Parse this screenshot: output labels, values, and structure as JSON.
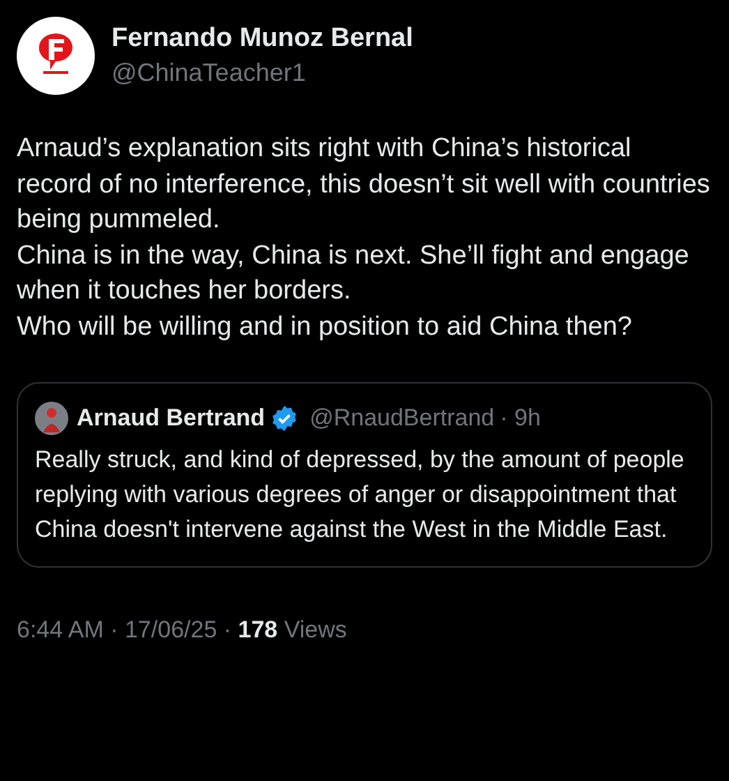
{
  "author": {
    "name": "Fernando Munoz Bernal",
    "handle": "@ChinaTeacher1"
  },
  "body": [
    "Arnaud’s explanation sits right with China’s historical record of no interference, this doesn’t sit well with countries being pummeled.",
    "China is in the way, China is next. She’ll fight and engage when it touches her borders.",
    "Who will be willing and in position to aid China then?"
  ],
  "quote": {
    "name": "Arnaud Bertrand",
    "verified": true,
    "handle": "@RnaudBertrand",
    "time": "· 9h",
    "text": "Really struck, and kind of depressed, by the amount of people replying with various degrees of anger or disappointment that China doesn't intervene against the West in the Middle East."
  },
  "footer": "6:44 AM · 17/06/25 · **178** Views"
}
